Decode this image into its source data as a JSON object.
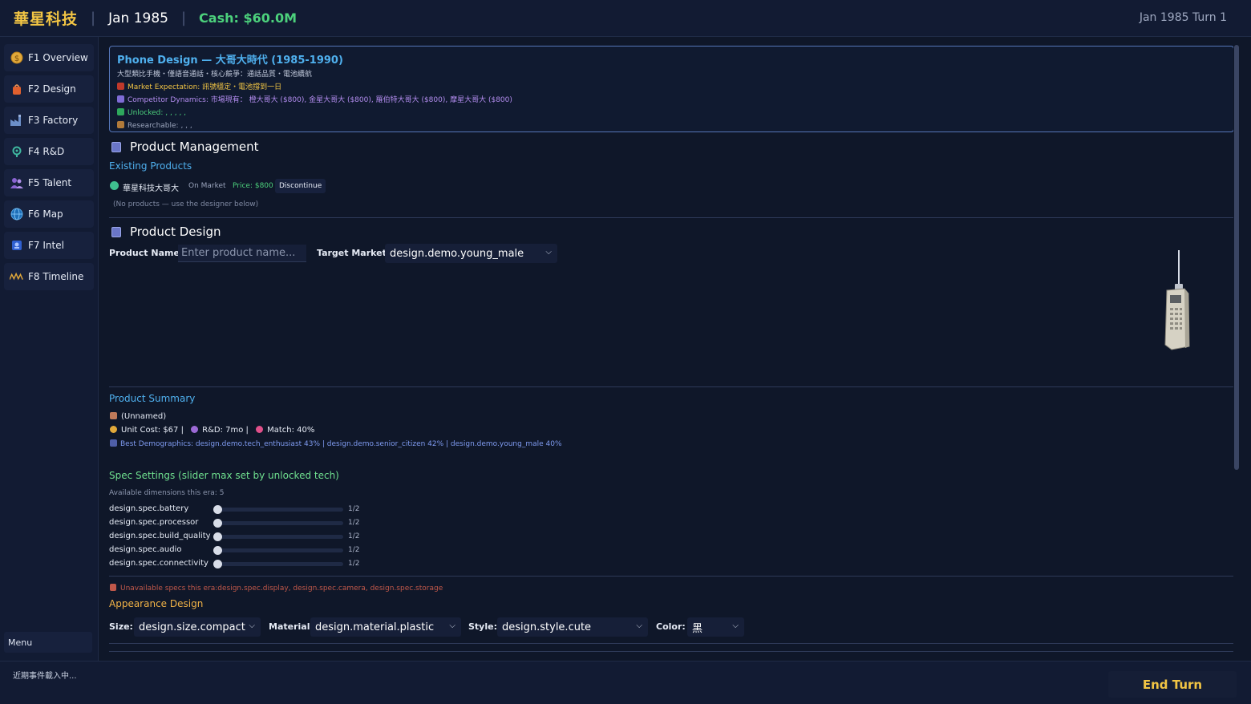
{
  "header": {
    "company": "華星科技",
    "date": "Jan 1985",
    "cash": "Cash: $60.0M",
    "turn": "Jan 1985 Turn 1"
  },
  "sidebar": {
    "items": [
      {
        "label": "F1 Overview",
        "icon": "coin-icon"
      },
      {
        "label": "F2 Design",
        "icon": "bag-icon"
      },
      {
        "label": "F3 Factory",
        "icon": "factory-icon"
      },
      {
        "label": "F4 R&D",
        "icon": "lab-icon"
      },
      {
        "label": "F5 Talent",
        "icon": "people-icon"
      },
      {
        "label": "F6 Map",
        "icon": "globe-icon"
      },
      {
        "label": "F7 Intel",
        "icon": "spy-icon"
      },
      {
        "label": "F8 Timeline",
        "icon": "timeline-icon"
      }
    ],
    "menu": "Menu"
  },
  "era": {
    "title": "Phone Design — 大哥大時代 (1985-1990)",
    "description": "大型類比手機・僅語音通話・核心競爭：通話品質・電池續航",
    "market_expectation": "Market Expectation: 訊號穩定・電池撐到一日",
    "competitor_dynamics": "Competitor Dynamics: 市場現有： 橙大哥大 ($800), 金星大哥大 ($800), 羅伯特大哥大 ($800), 摩星大哥大 ($800)",
    "unlocked": "Unlocked: , , , , ,",
    "researchable": "Researchable: , , ,"
  },
  "product_management": {
    "title": "Product Management",
    "existing_label": "Existing Products",
    "product": {
      "name": "華星科技大哥大",
      "status": "On Market",
      "price": "Price: $800",
      "discontinue": "Discontinue"
    },
    "empty_note": "(No products — use the designer below)"
  },
  "product_design": {
    "title": "Product Design",
    "name_label": "Product Name:",
    "name_placeholder": "Enter product name...",
    "market_label": "Target Market:",
    "market_value": "design.demo.young_male"
  },
  "summary": {
    "title": "Product Summary",
    "name": "(Unnamed)",
    "unit_cost": "Unit Cost: $67 |",
    "rd": "R&D: 7mo |",
    "match": "Match: 40%",
    "best_demographics": "Best Demographics: design.demo.tech_enthusiast 43% | design.demo.senior_citizen 42% | design.demo.young_male 40%"
  },
  "specs": {
    "title": "Spec Settings (slider max set by unlocked tech)",
    "available": "Available dimensions this era: 5",
    "items": [
      {
        "label": "design.spec.battery",
        "value": "1/2",
        "level": 0
      },
      {
        "label": "design.spec.processor",
        "value": "1/2",
        "level": 0
      },
      {
        "label": "design.spec.build_quality",
        "value": "1/2",
        "level": 0
      },
      {
        "label": "design.spec.audio",
        "value": "1/2",
        "level": 0
      },
      {
        "label": "design.spec.connectivity",
        "value": "1/2",
        "level": 0
      }
    ],
    "unavailable": "Unavailable specs this era:design.spec.display, design.spec.camera, design.spec.storage"
  },
  "appearance": {
    "title": "Appearance Design",
    "size_label": "Size:",
    "size_value": "design.size.compact",
    "material_label": "Material:",
    "material_value": "design.material.plastic",
    "style_label": "Style:",
    "style_value": "design.style.cute",
    "color_label": "Color:",
    "color_value": "黑"
  },
  "footer": {
    "events": "近期事件載入中...",
    "end_turn": "End Turn"
  },
  "colors": {
    "accent_blue": "#4fb0ee",
    "gold": "#f2c544",
    "cash_green": "#4cd17c",
    "spec_green": "#6fe08f",
    "appearance_orange": "#f2b347",
    "background": "#0f1729"
  }
}
